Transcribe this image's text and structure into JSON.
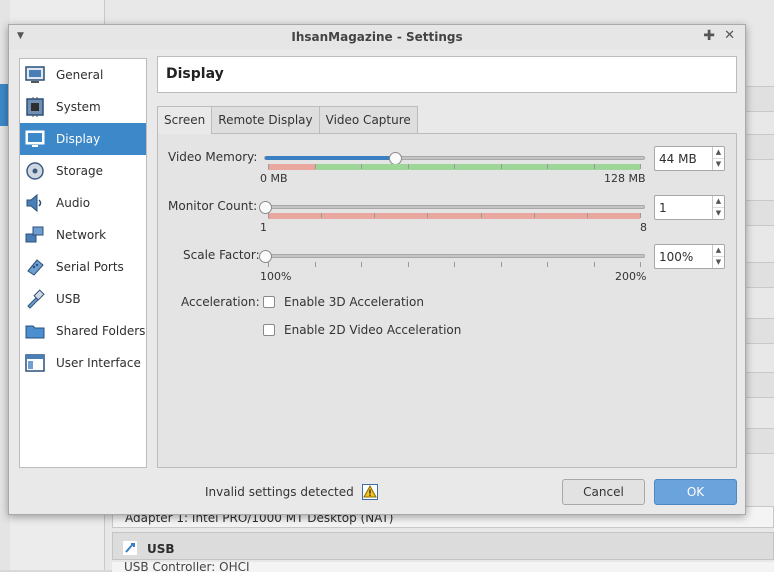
{
  "background": {
    "adapter_text": "Adapter 1:   Intel PRO/1000 MT Desktop (NAT)",
    "usb_section": "USB",
    "usb_controller": "USB Controller:   OHCI"
  },
  "window": {
    "title": "IhsanMagazine - Settings"
  },
  "sidebar": {
    "items": [
      {
        "label": "General",
        "icon": "general-icon"
      },
      {
        "label": "System",
        "icon": "system-icon"
      },
      {
        "label": "Display",
        "icon": "display-icon",
        "selected": true
      },
      {
        "label": "Storage",
        "icon": "storage-icon"
      },
      {
        "label": "Audio",
        "icon": "audio-icon"
      },
      {
        "label": "Network",
        "icon": "network-icon"
      },
      {
        "label": "Serial Ports",
        "icon": "serial-ports-icon"
      },
      {
        "label": "USB",
        "icon": "usb-icon"
      },
      {
        "label": "Shared Folders",
        "icon": "shared-folders-icon"
      },
      {
        "label": "User Interface",
        "icon": "user-interface-icon"
      }
    ]
  },
  "page": {
    "title": "Display"
  },
  "tabs": [
    {
      "label": "Screen",
      "active": true
    },
    {
      "label": "Remote Display"
    },
    {
      "label": "Video Capture"
    }
  ],
  "screen": {
    "video_memory": {
      "label": "Video Memory:",
      "value": "44 MB",
      "min_label": "0 MB",
      "max_label": "128 MB",
      "min": 0,
      "max": 128,
      "current": 44
    },
    "monitor_count": {
      "label": "Monitor Count:",
      "value": "1",
      "min_label": "1",
      "max_label": "8",
      "min": 1,
      "max": 8,
      "current": 1
    },
    "scale_factor": {
      "label": "Scale Factor:",
      "value": "100%",
      "min_label": "100%",
      "max_label": "200%",
      "min": 100,
      "max": 200,
      "current": 100
    },
    "acceleration": {
      "label": "Acceleration:",
      "enable_3d": {
        "label": "Enable 3D Acceleration",
        "checked": false
      },
      "enable_2d": {
        "label": "Enable 2D Video Acceleration",
        "checked": false
      }
    }
  },
  "footer": {
    "warning": "Invalid settings detected",
    "cancel_label": "Cancel",
    "ok_label": "OK"
  },
  "colors": {
    "selection": "#3c88c8",
    "slider_fill": "#3a7fc2",
    "range_bad": "#e8a8a0",
    "range_good": "#9ed69a",
    "ok_button": "#6ba3dc"
  }
}
